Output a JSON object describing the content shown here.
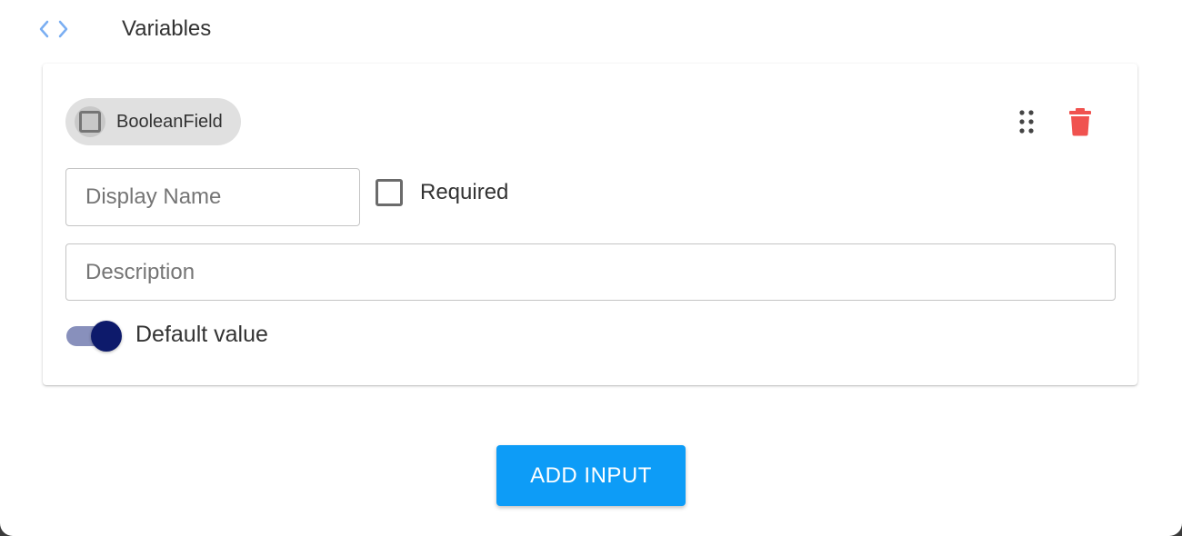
{
  "header": {
    "icon": "code-icon",
    "title": "Variables"
  },
  "card": {
    "chip": {
      "icon": "checkbox-outline-icon",
      "label": "BooleanField"
    },
    "actions": {
      "drag_icon": "drag-handle-icon",
      "delete_icon": "trash-icon",
      "delete_color": "#f0524f"
    },
    "display_name": {
      "placeholder": "Display Name",
      "value": ""
    },
    "required": {
      "label": "Required",
      "checked": false
    },
    "description": {
      "placeholder": "Description",
      "value": ""
    },
    "default_value": {
      "label": "Default value",
      "on": true
    }
  },
  "add_input": {
    "label": "ADD INPUT"
  },
  "colors": {
    "accent": "#0d9cf7",
    "toggle_thumb": "#0d1a6b",
    "toggle_track": "#8890bc",
    "code_icon": "#7aaef2"
  }
}
